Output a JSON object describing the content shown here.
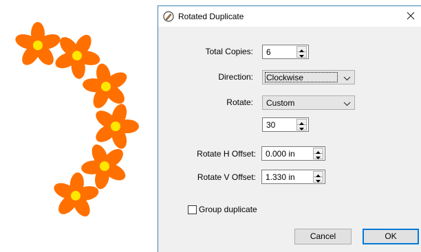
{
  "dialog": {
    "title": "Rotated Duplicate",
    "close_glyph": "✕",
    "fields": {
      "total_copies": {
        "label": "Total Copies:",
        "value": "6"
      },
      "direction": {
        "label": "Direction:",
        "value": "Clockwise"
      },
      "rotate": {
        "label": "Rotate:",
        "value": "Custom",
        "angle": "30"
      },
      "rotate_h_offset": {
        "label": "Rotate H Offset:",
        "value": "0.000 in"
      },
      "rotate_v_offset": {
        "label": "Rotate V Offset:",
        "value": "1.330 in"
      }
    },
    "group_duplicate": {
      "label": "Group duplicate",
      "checked": false
    },
    "buttons": {
      "cancel": "Cancel",
      "ok": "OK"
    }
  },
  "canvas": {
    "flower_count": 6,
    "petal_color": "#ff7000",
    "center_color": "#ffe800"
  },
  "icons": [
    "pencil-icon",
    "close-icon",
    "chevron-down-icon",
    "spin-up-icon",
    "spin-down-icon"
  ]
}
